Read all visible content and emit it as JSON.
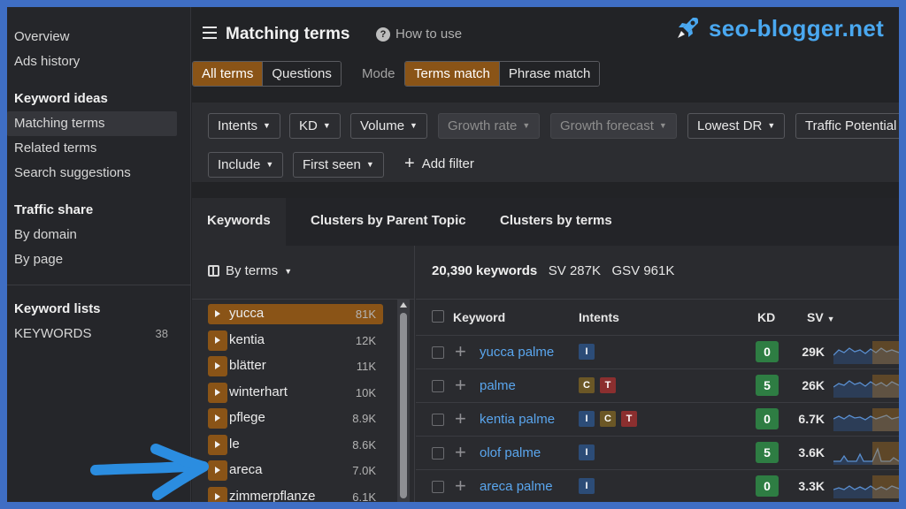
{
  "sidebar": {
    "top_items": [
      {
        "label": "Overview"
      },
      {
        "label": "Ads history"
      }
    ],
    "keyword_ideas": {
      "heading": "Keyword ideas",
      "items": [
        {
          "label": "Matching terms",
          "active": true
        },
        {
          "label": "Related terms"
        },
        {
          "label": "Search suggestions"
        }
      ]
    },
    "traffic_share": {
      "heading": "Traffic share",
      "items": [
        {
          "label": "By domain"
        },
        {
          "label": "By page"
        }
      ]
    },
    "keyword_lists": {
      "heading": "Keyword lists",
      "items": [
        {
          "label": "KEYWORDS",
          "count": "38"
        }
      ]
    }
  },
  "header": {
    "title": "Matching terms",
    "how_to_use": "How to use",
    "logo_text": "seo-blogger.net",
    "term_scope": {
      "all": "All terms",
      "questions": "Questions"
    },
    "mode_label": "Mode",
    "mode": {
      "terms": "Terms match",
      "phrase": "Phrase match"
    }
  },
  "filters": {
    "row1": [
      "Intents",
      "KD",
      "Volume",
      "Growth rate",
      "Growth forecast",
      "Lowest DR",
      "Traffic Potential"
    ],
    "row2": [
      "Include",
      "First seen"
    ],
    "add_filter": "Add filter"
  },
  "tabs": [
    "Keywords",
    "Clusters by Parent Topic",
    "Clusters by terms"
  ],
  "terms_panel": {
    "by_terms": "By terms",
    "terms": [
      {
        "label": "yucca",
        "count": "81K"
      },
      {
        "label": "kentia",
        "count": "12K"
      },
      {
        "label": "blätter",
        "count": "11K"
      },
      {
        "label": "winterhart",
        "count": "10K"
      },
      {
        "label": "pflege",
        "count": "8.9K"
      },
      {
        "label": "le",
        "count": "8.6K"
      },
      {
        "label": "areca",
        "count": "7.0K"
      },
      {
        "label": "zimmerpflanze",
        "count": "6.1K"
      }
    ]
  },
  "results": {
    "count": "20,390 keywords",
    "sv": "SV 287K",
    "gsv": "GSV 961K",
    "columns": {
      "keyword": "Keyword",
      "intents": "Intents",
      "kd": "KD",
      "sv": "SV"
    },
    "rows": [
      {
        "keyword": "yucca palme",
        "intents": [
          "I"
        ],
        "kd": "0",
        "sv": "29K"
      },
      {
        "keyword": "palme",
        "intents": [
          "C",
          "T"
        ],
        "kd": "5",
        "sv": "26K"
      },
      {
        "keyword": "kentia palme",
        "intents": [
          "I",
          "C",
          "T"
        ],
        "kd": "0",
        "sv": "6.7K"
      },
      {
        "keyword": "olof palme",
        "intents": [
          "I"
        ],
        "kd": "5",
        "sv": "3.6K"
      },
      {
        "keyword": "areca palme",
        "intents": [
          "I"
        ],
        "kd": "0",
        "sv": "3.3K"
      }
    ]
  },
  "colors": {
    "accent_orange": "#8a5417",
    "link_blue": "#5aa6ee",
    "kd_green": "#2e7d43",
    "intent_informational": "#2c4c77",
    "intent_commercial": "#6b5726",
    "intent_transactional": "#8b2f2f",
    "annotation_arrow": "#2b8de0"
  },
  "icons": {
    "menu": "hamburger-icon",
    "help": "question-circle-icon",
    "logo": "rocket-icon",
    "add": "plus-icon",
    "sort": "caret-down-icon"
  }
}
